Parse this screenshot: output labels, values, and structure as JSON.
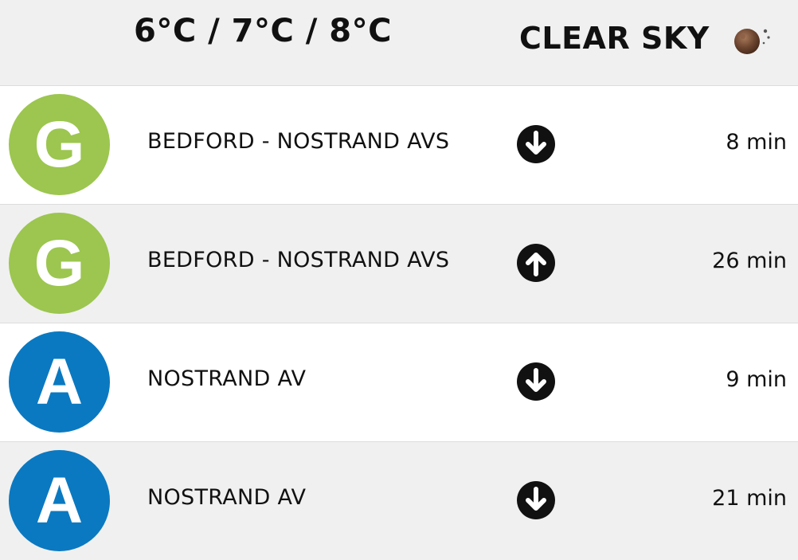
{
  "header": {
    "temperatures": "6°C / 7°C / 8°C",
    "condition": "CLEAR SKY",
    "weather_icon": "clear-sky-night-icon"
  },
  "colors": {
    "line_g": "#9cc64f",
    "line_a": "#0a79c1",
    "row_alt_bg": "#f0f0f0",
    "header_bg": "#f0f0f0"
  },
  "arrivals": [
    {
      "route": "G",
      "station": "BEDFORD - NOSTRAND AVS",
      "direction": "down",
      "direction_icon": "arrow-down-circle-icon",
      "eta": "8 min"
    },
    {
      "route": "G",
      "station": "BEDFORD - NOSTRAND AVS",
      "direction": "up",
      "direction_icon": "arrow-up-circle-icon",
      "eta": "26 min"
    },
    {
      "route": "A",
      "station": "NOSTRAND AV",
      "direction": "down",
      "direction_icon": "arrow-down-circle-icon",
      "eta": "9 min"
    },
    {
      "route": "A",
      "station": "NOSTRAND AV",
      "direction": "down",
      "direction_icon": "arrow-down-circle-icon",
      "eta": "21 min"
    }
  ]
}
